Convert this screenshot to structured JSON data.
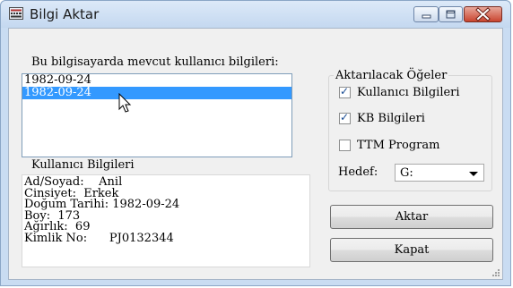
{
  "window": {
    "title": "Bilgi Aktar"
  },
  "existing_users": {
    "label": "Bu bilgisayarda mevcut kullanıcı bilgileri:",
    "items": [
      "1982-09-24",
      "1982-09-24"
    ],
    "selected_index": 1
  },
  "user_info": {
    "label": "Kullanıcı Bilgileri",
    "lines": [
      "Ad/Soyad:    Anil",
      "Cinsiyet:  Erkek",
      "Doğum Tarihi: 1982-09-24",
      "Boy:  173",
      "Ağırlık:  69",
      "Kimlik No:      PJ0132344"
    ]
  },
  "transfer_items": {
    "label": "Aktarılacak Öğeler",
    "options": [
      {
        "label": "Kullanıcı Bilgileri",
        "checked": true
      },
      {
        "label": "KB Bilgileri",
        "checked": true
      },
      {
        "label": "TTM Program",
        "checked": false
      }
    ],
    "target_label": "Hedef:",
    "target_value": "G:"
  },
  "buttons": {
    "transfer": "Aktar",
    "close": "Kapat"
  }
}
